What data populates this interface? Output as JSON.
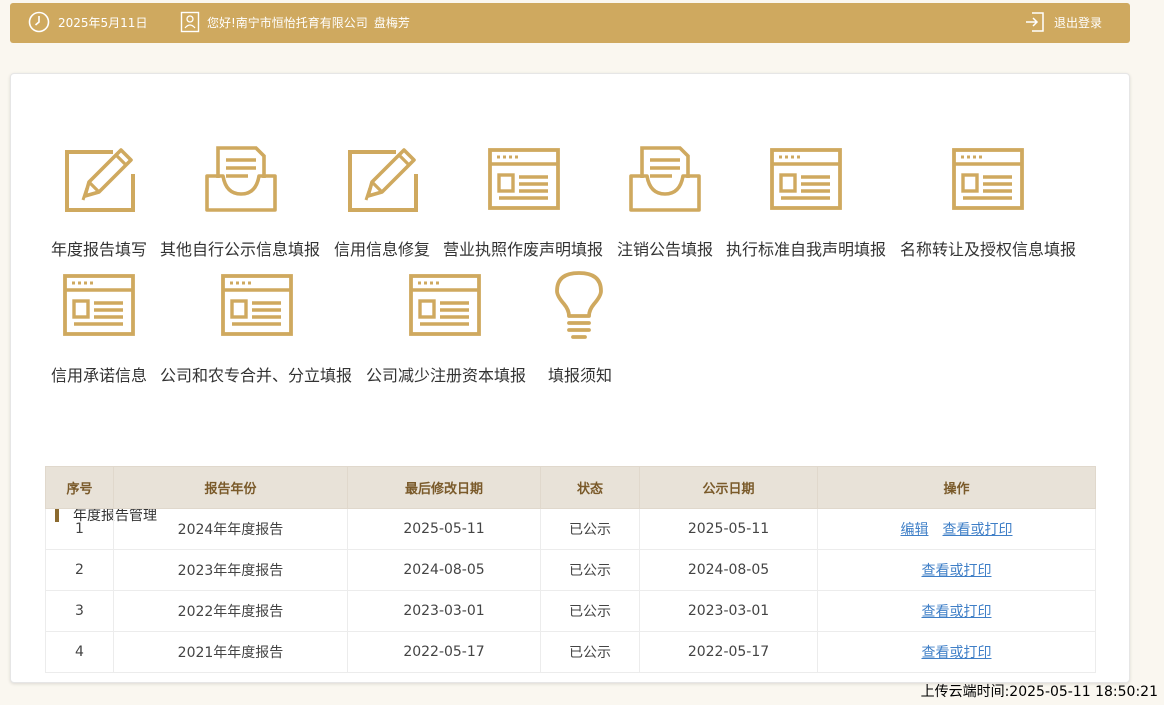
{
  "header": {
    "date": "2025年5月11日",
    "greeting": "您好!南宁市恒怡托育有限公司",
    "user": "盘梅芳",
    "logout": "退出登录",
    "bg_color": "#cfa95f"
  },
  "tiles": [
    {
      "label": "年度报告填写",
      "icon": "pencil-edit-icon"
    },
    {
      "label": "其他自行公示信息填报",
      "icon": "inbox-tray-icon"
    },
    {
      "label": "信用信息修复",
      "icon": "pencil-edit-icon"
    },
    {
      "label": "营业执照作废声明填报",
      "icon": "browser-form-icon"
    },
    {
      "label": "注销公告填报",
      "icon": "inbox-tray-icon"
    },
    {
      "label": "执行标准自我声明填报",
      "icon": "browser-form-icon"
    },
    {
      "label": "名称转让及授权信息填报",
      "icon": "browser-form-icon"
    },
    {
      "label": "信用承诺信息",
      "icon": "browser-form-icon"
    },
    {
      "label": "公司和农专合并、分立填报",
      "icon": "browser-form-icon"
    },
    {
      "label": "公司减少注册资本填报",
      "icon": "browser-form-icon"
    },
    {
      "label": "填报须知",
      "icon": "lightbulb-icon"
    }
  ],
  "section_title": "年度报告管理",
  "table": {
    "headers": [
      "序号",
      "报告年份",
      "最后修改日期",
      "状态",
      "公示日期",
      "操作"
    ],
    "rows": [
      {
        "no": "1",
        "year": "2024年年度报告",
        "modified": "2025-05-11",
        "status": "已公示",
        "published": "2025-05-11",
        "actions": [
          "编辑",
          "查看或打印"
        ]
      },
      {
        "no": "2",
        "year": "2023年年度报告",
        "modified": "2024-08-05",
        "status": "已公示",
        "published": "2024-08-05",
        "actions": [
          "查看或打印"
        ]
      },
      {
        "no": "3",
        "year": "2022年年度报告",
        "modified": "2023-03-01",
        "status": "已公示",
        "published": "2023-03-01",
        "actions": [
          "查看或打印"
        ]
      },
      {
        "no": "4",
        "year": "2021年年度报告",
        "modified": "2022-05-17",
        "status": "已公示",
        "published": "2022-05-17",
        "actions": [
          "查看或打印"
        ]
      }
    ]
  },
  "upload_time": "上传云端时间:2025-05-11 18:50:21",
  "colors": {
    "accent": "#cfa95f",
    "link": "#3f7fc7",
    "header_cell": "#e8e2d8"
  }
}
